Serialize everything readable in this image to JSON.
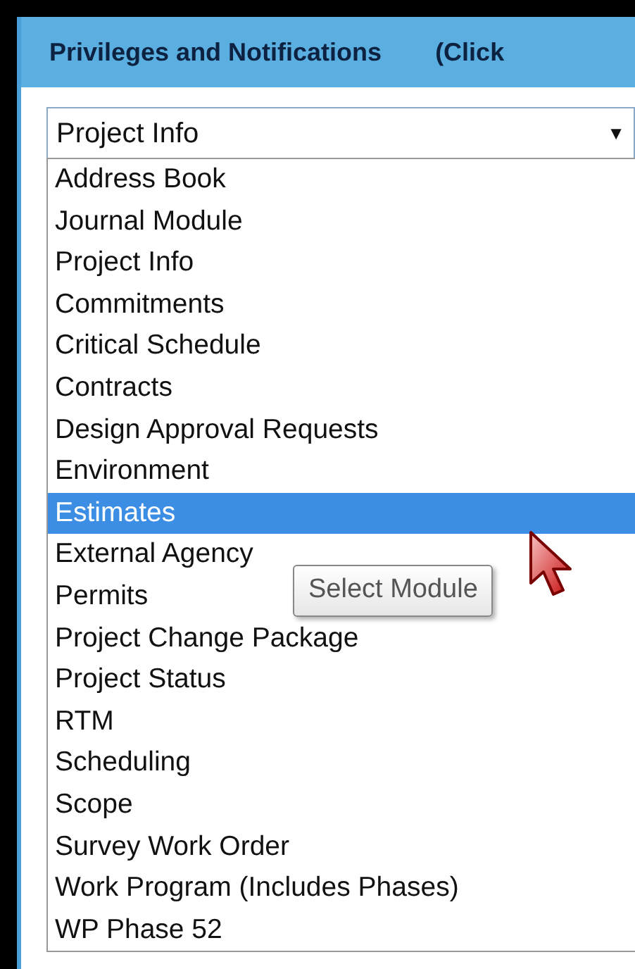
{
  "header": {
    "title": "Privileges and Notifications",
    "hint": "(Click"
  },
  "module_select": {
    "value": "Project Info",
    "arrow": "▼"
  },
  "options": [
    {
      "label": "Address Book",
      "selected": false
    },
    {
      "label": "Journal Module",
      "selected": false
    },
    {
      "label": "Project Info",
      "selected": false
    },
    {
      "label": "Commitments",
      "selected": false
    },
    {
      "label": "Critical Schedule",
      "selected": false
    },
    {
      "label": "Contracts",
      "selected": false
    },
    {
      "label": "Design Approval Requests",
      "selected": false
    },
    {
      "label": "Environment",
      "selected": false
    },
    {
      "label": "Estimates",
      "selected": true
    },
    {
      "label": "External Agency",
      "selected": false
    },
    {
      "label": "Permits",
      "selected": false
    },
    {
      "label": "Project Change Package",
      "selected": false
    },
    {
      "label": "Project Status",
      "selected": false
    },
    {
      "label": "RTM",
      "selected": false
    },
    {
      "label": "Scheduling",
      "selected": false
    },
    {
      "label": "Scope",
      "selected": false
    },
    {
      "label": "Survey Work Order",
      "selected": false
    },
    {
      "label": "Work Program (Includes Phases)",
      "selected": false
    },
    {
      "label": "WP Phase 52",
      "selected": false
    }
  ],
  "tooltip": {
    "text": "Select Module"
  }
}
